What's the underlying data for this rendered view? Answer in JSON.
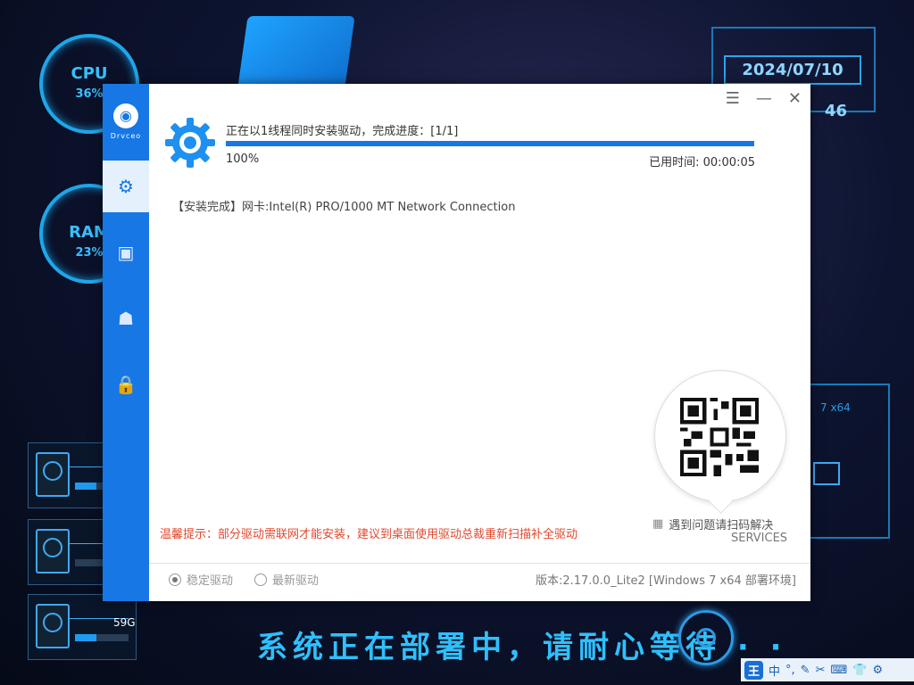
{
  "desktop": {
    "cpu_label": "CPU",
    "cpu_value": "36%",
    "ram_label": "RAM",
    "ram_value": "23%",
    "date": "2024/07/10",
    "time_fragment": "46",
    "disk_size": "59G",
    "os_label": "7 x64",
    "slogan": "系统正在部署中，请耐心等待 · ·"
  },
  "taskbar": {
    "items": [
      "王",
      "中",
      "°,",
      "✎",
      "✂",
      "⌨",
      "👕",
      "⚙"
    ]
  },
  "app": {
    "logo_text": "Drvceo",
    "nav": [
      "settings",
      "toolbox",
      "user",
      "lock"
    ],
    "window_controls": [
      "☰",
      "—",
      "✕"
    ],
    "status_text": "正在以1线程同时安装驱动，完成进度：[1/1]",
    "progress_fraction": 1.0,
    "percent_text": "100%",
    "elapsed_text": "已用时间: 00:00:05",
    "log_tag": "【安装完成】",
    "log_text": "网卡:Intel(R) PRO/1000 MT Network Connection",
    "tip_text": "温馨提示：部分驱动需联网才能安装，建议到桌面使用驱动总裁重新扫描补全驱动",
    "services_line1": "遇到问题请扫码解决",
    "services_line2": "SERVICES",
    "radio_stable": "稳定驱动",
    "radio_latest": "最新驱动",
    "version_text": "版本:2.17.0.0_Lite2 [Windows 7 x64 部署环境]"
  },
  "colors": {
    "accent": "#1677e5",
    "tip": "#e0492f"
  }
}
